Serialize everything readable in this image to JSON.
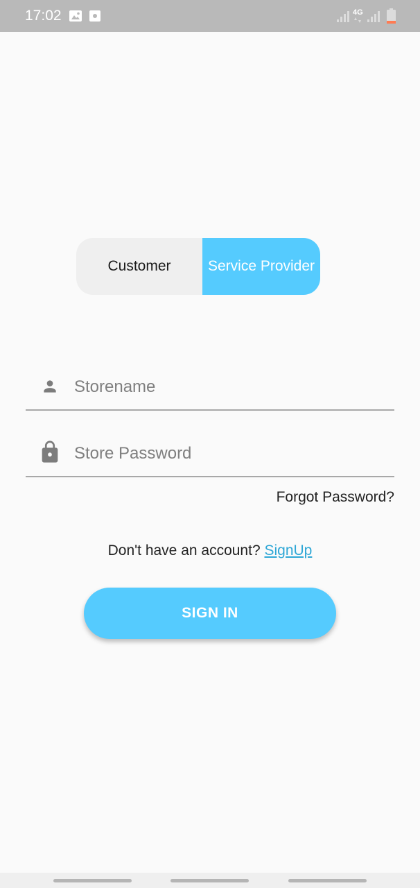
{
  "status_bar": {
    "time": "17:02",
    "network": "4G"
  },
  "role_toggle": {
    "options": [
      {
        "label": "Customer",
        "selected": false
      },
      {
        "label": "Service Provider",
        "selected": true
      }
    ]
  },
  "form": {
    "storename_placeholder": "Storename",
    "password_placeholder": "Store Password",
    "forgot_label": "Forgot Password?"
  },
  "signup": {
    "prompt": "Don't have an account?",
    "link_label": "SignUp"
  },
  "signin_label": "SIGN IN",
  "colors": {
    "accent": "#55cbfe",
    "link": "#2ea7d6",
    "background": "#fafafa"
  }
}
